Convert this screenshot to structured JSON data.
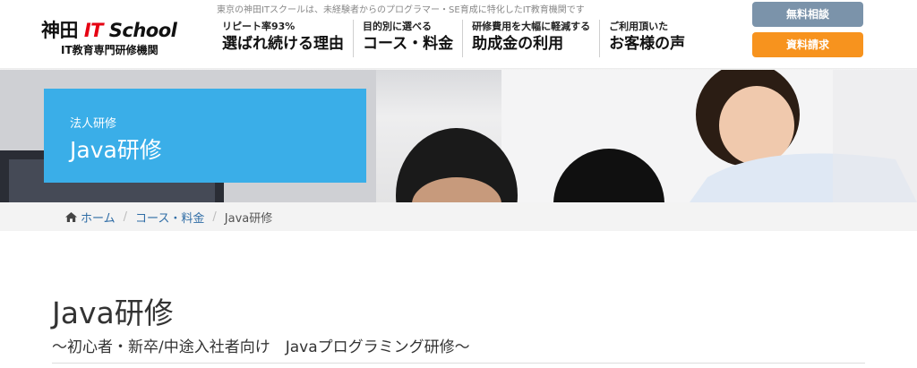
{
  "header": {
    "tagline": "東京の神田ITスクールは、未経験者からのプログラマー・SE育成に特化したIT教育機関です",
    "logo": {
      "prefix": "神田",
      "it": "IT",
      "school": "School",
      "sub": "IT教育専門研修機関"
    },
    "nav": [
      {
        "small": "リピート率93%",
        "big": "選ばれ続ける理由"
      },
      {
        "small": "目的別に選べる",
        "big": "コース・料金"
      },
      {
        "small": "研修費用を大幅に軽減する",
        "big": "助成金の利用"
      },
      {
        "small": "ご利用頂いた",
        "big": "お客様の声"
      }
    ],
    "buttons": {
      "consult": "無料相談",
      "docs": "資料請求"
    },
    "colors": {
      "consult": "#7b93aa",
      "docs": "#f7931e",
      "logo_it": "#e60012"
    }
  },
  "hero": {
    "sub": "法人研修",
    "title": "Java研修",
    "box_color": "#3aaee8"
  },
  "breadcrumb": {
    "home": "ホーム",
    "separator": "/",
    "course": "コース・料金",
    "current": "Java研修"
  },
  "main": {
    "title": "Java研修",
    "subtitle": "～初心者・新卒/中途入社者向け　Javaプログラミング研修～"
  }
}
